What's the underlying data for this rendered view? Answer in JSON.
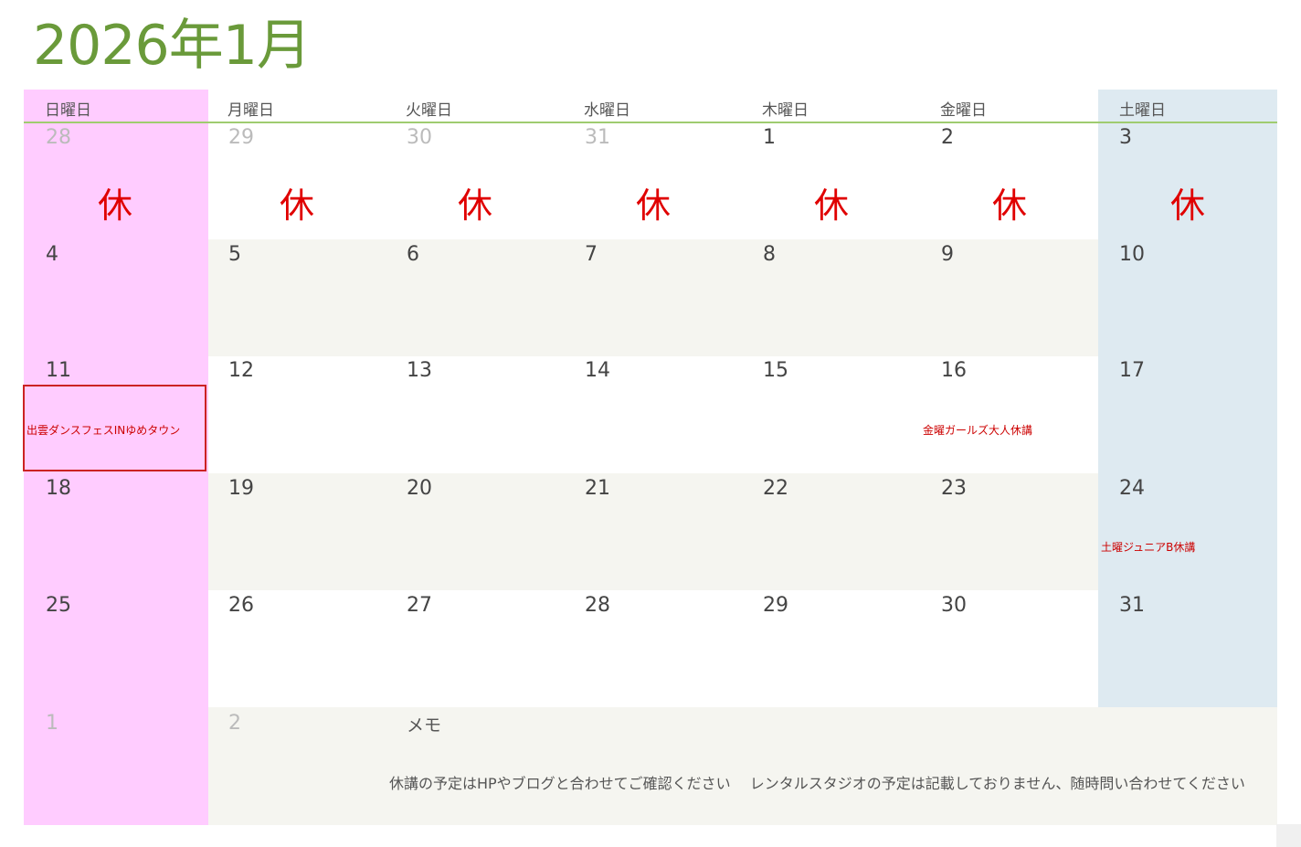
{
  "title": "2026年1月",
  "weekdays": [
    "日曜日",
    "月曜日",
    "火曜日",
    "水曜日",
    "木曜日",
    "金曜日",
    "土曜日"
  ],
  "weeks": [
    [
      "28",
      "29",
      "30",
      "31",
      "1",
      "2",
      "3"
    ],
    [
      "4",
      "5",
      "6",
      "7",
      "8",
      "9",
      "10"
    ],
    [
      "11",
      "12",
      "13",
      "14",
      "15",
      "16",
      "17"
    ],
    [
      "18",
      "19",
      "20",
      "21",
      "22",
      "23",
      "24"
    ],
    [
      "25",
      "26",
      "27",
      "28",
      "29",
      "30",
      "31"
    ],
    [
      "1",
      "2"
    ]
  ],
  "holiday_mark": "休",
  "events": {
    "jan11": "出雲ダンスフェスINゆめタウン",
    "jan16": "金曜ガールズ大人休講",
    "jan24": "土曜ジュニアB休講"
  },
  "memo": {
    "label": "メモ",
    "text": "休講の予定はHPやブログと合わせてご確認ください　 レンタルスタジオの予定は記載しておりません、随時問い合わせてください"
  },
  "colors": {
    "title": "#6a9a3a",
    "sunday_bg": "#ffccff",
    "saturday_bg": "#deeaf1",
    "alt_row_bg": "#f5f5f0",
    "holiday_text": "#e00000",
    "event_text": "#cc0000",
    "header_line": "#9fcc70"
  }
}
